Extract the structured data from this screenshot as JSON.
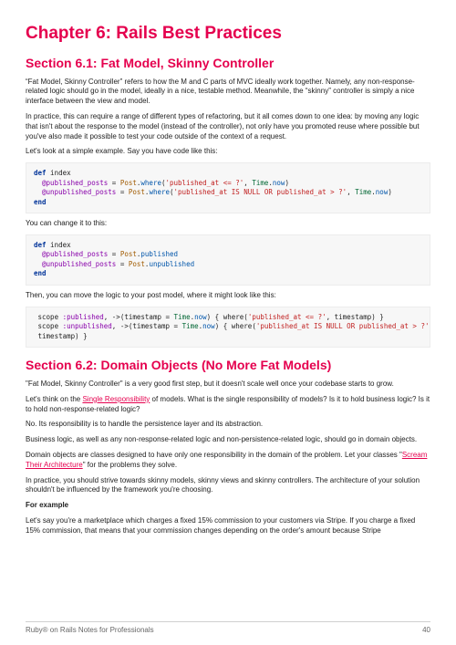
{
  "chapter_title": "Chapter 6: Rails Best Practices",
  "section1": {
    "title": "Section 6.1: Fat Model, Skinny Controller",
    "p1": "“Fat Model, Skinny Controller” refers to how the M and C parts of MVC ideally work together. Namely, any non-response-related logic should go in the model, ideally in a nice, testable method. Meanwhile, the “skinny” controller is simply a nice interface between the view and model.",
    "p2": "In practice, this can require a range of different types of refactoring, but it all comes down to one idea: by moving any logic that isn't about the response to the model (instead of the controller), not only have you promoted reuse where possible but you've also made it possible to test your code outside of the context of a request.",
    "p3": "Let's look at a simple example. Say you have code like this:",
    "p4": "You can change it to this:",
    "p5": "Then, you can move the logic to your post model, where it might look like this:"
  },
  "code1": {
    "l1_def": "def",
    "l1_name": " index",
    "l2_iv": "  @published_posts",
    "l2_eq": " = ",
    "l2_cls": "Post",
    "l2_dot": ".",
    "l2_where": "where",
    "l2_open": "(",
    "l2_str": "'published_at <= ?'",
    "l2_comma": ", ",
    "l2_time": "Time",
    "l2_dot2": ".",
    "l2_now": "now",
    "l2_close": ")",
    "l3_iv": "  @unpublished_posts",
    "l3_eq": " = ",
    "l3_cls": "Post",
    "l3_dot": ".",
    "l3_where": "where",
    "l3_open": "(",
    "l3_str": "'published_at IS NULL OR published_at > ?'",
    "l3_comma": ", ",
    "l3_time": "Time",
    "l3_dot2": ".",
    "l3_now": "now",
    "l3_close": ")",
    "l4_end": "end"
  },
  "code2": {
    "l1_def": "def",
    "l1_name": " index",
    "l2_iv": "  @published_posts",
    "l2_eq": " = ",
    "l2_cls": "Post",
    "l2_dot": ".",
    "l2_m": "published",
    "l3_iv": "  @unpublished_posts",
    "l3_eq": " = ",
    "l3_cls": "Post",
    "l3_dot": ".",
    "l3_m": "unpublished",
    "l4_end": "end"
  },
  "code3": {
    "l1a": " scope ",
    "l1_sym": ":published",
    "l1b": ", ->(timestamp = ",
    "l1_time": "Time",
    "l1_dot": ".",
    "l1_now": "now",
    "l1c": ") { where(",
    "l1_str": "'published_at <= ?'",
    "l1d": ", timestamp) }",
    "l2a": " scope ",
    "l2_sym": ":unpublished",
    "l2b": ", ->(timestamp = ",
    "l2_time": "Time",
    "l2_dot": ".",
    "l2_now": "now",
    "l2c": ") { where(",
    "l2_str": "'published_at IS NULL OR published_at > ?'",
    "l2d": ",",
    "l3": " timestamp) }"
  },
  "section2": {
    "title": "Section 6.2: Domain Objects (No More Fat Models)",
    "p1": "\"Fat Model, Skinny Controller\" is a very good first step, but it doesn't scale well once your codebase starts to grow.",
    "p2a": "Let's think on the ",
    "p2_link": "Single Responsibility",
    "p2b": " of models. What is the single responsibility of models? Is it to hold business logic? Is it to hold non-response-related logic?",
    "p3": "No. Its responsibility is to handle the persistence layer and its abstraction.",
    "p4": "Business logic, as well as any non-response-related logic and non-persistence-related logic, should go in domain objects.",
    "p5a": "Domain objects are classes designed to have only one responsibility in the domain of the problem. Let your classes \"",
    "p5_link": "Scream Their Architecture",
    "p5b": "\" for the problems they solve.",
    "p6": "In practice, you should strive towards skinny models, skinny views and skinny controllers. The architecture of your solution shouldn't be influenced by the framework you're choosing.",
    "p7": "For example",
    "p8": "Let's say you're a marketplace which charges a fixed 15% commission to your customers via Stripe. If you charge a fixed 15% commission, that means that your commission changes depending on the order's amount because Stripe"
  },
  "footer": {
    "left": "Ruby® on Rails Notes for Professionals",
    "right": "40"
  }
}
